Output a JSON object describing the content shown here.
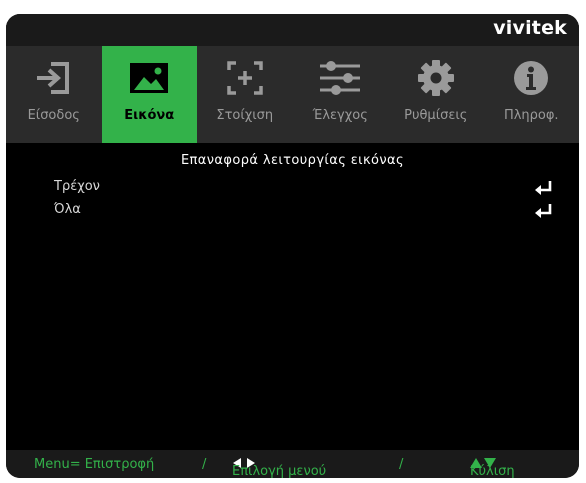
{
  "brand": "vivitek",
  "tabs": [
    {
      "label": "Είσοδος",
      "icon": "input-icon",
      "active": false
    },
    {
      "label": "Εικόνα",
      "icon": "picture-icon",
      "active": true
    },
    {
      "label": "Στοίχιση",
      "icon": "alignment-icon",
      "active": false
    },
    {
      "label": "Έλεγχος",
      "icon": "sliders-icon",
      "active": false
    },
    {
      "label": "Ρυθμίσεις",
      "icon": "gear-icon",
      "active": false
    },
    {
      "label": "Πληροφ.",
      "icon": "info-icon",
      "active": false
    }
  ],
  "content": {
    "title": "Επαναφορά λειτουργίας εικόνας",
    "items": [
      {
        "label": "Τρέχον",
        "icon": "enter-icon"
      },
      {
        "label": "Όλα",
        "icon": "enter-icon"
      }
    ]
  },
  "footer": {
    "back": "Menu= Επιστροφή",
    "sep1": "/",
    "select": "Επιλογή μενού",
    "sep2": "/",
    "scroll": "Κύλιση"
  },
  "colors": {
    "accent": "#33b24a",
    "tab_bar": "#2b2b2b",
    "background": "#000000"
  }
}
